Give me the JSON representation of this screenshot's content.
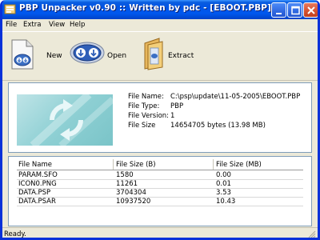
{
  "window": {
    "title": "PBP Unpacker v0.90 :: Written by pdc - [EBOOT.PBP]"
  },
  "menu": {
    "items": [
      {
        "label": "File"
      },
      {
        "label": "Extra"
      },
      {
        "label": "View"
      },
      {
        "label": "Help"
      }
    ]
  },
  "toolbar": {
    "new_label": "New",
    "open_label": "Open",
    "extract_label": "Extract"
  },
  "info": {
    "file_name_label": "File Name:",
    "file_name": "C:\\psp\\update\\11-05-2005\\EBOOT.PBP",
    "file_type_label": "File Type:",
    "file_type": "PBP",
    "file_version_label": "File Version:",
    "file_version": "1",
    "file_size_label": "File Size",
    "file_size": "14654705 bytes (13.98 MB)"
  },
  "list": {
    "columns": [
      "File Name",
      "File Size (B)",
      "File Size (MB)"
    ],
    "rows": [
      {
        "name": "PARAM.SFO",
        "size_b": "1580",
        "size_mb": "0.00"
      },
      {
        "name": "ICON0.PNG",
        "size_b": "11261",
        "size_mb": "0.01"
      },
      {
        "name": "DATA.PSP",
        "size_b": "3704304",
        "size_mb": "3.53"
      },
      {
        "name": "DATA.PSAR",
        "size_b": "10937520",
        "size_mb": "10.43"
      }
    ]
  },
  "status": {
    "text": "Ready."
  },
  "colors": {
    "titlebar": "#0058ee",
    "panel_border": "#7f9db9",
    "preview_bg": "#8fd0d4"
  }
}
